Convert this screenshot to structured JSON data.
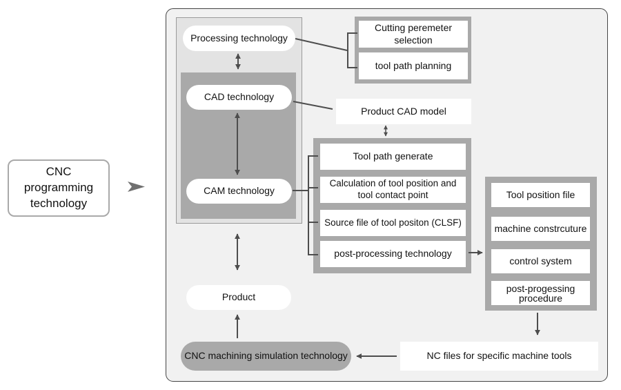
{
  "root": {
    "label": "CNC programming technology"
  },
  "left_column": {
    "processing": "Processing technology",
    "cad": "CAD technology",
    "cam": "CAM technology",
    "product": "Product",
    "simulation": "CNC machining simulation technology"
  },
  "processing_group": {
    "items": [
      "Cutting peremeter selection",
      "tool path planning"
    ]
  },
  "cad_model": {
    "label": "Product CAD model"
  },
  "cam_group": {
    "items": [
      "Tool path generate",
      "Calculation of tool position and tool contact point",
      "Source file of tool positon (CLSF)",
      "post-processing technology"
    ]
  },
  "post_group": {
    "items": [
      "Tool position file",
      "machine constrcuture",
      "control system",
      "post-progessing procedure"
    ]
  },
  "nc_files": {
    "label": "NC files for specific machine tools"
  },
  "colors": {
    "frame_bg": "#f1f1f1",
    "panel_gray": "#a9a9a9",
    "light_panel": "#e3e3e3",
    "line": "#4d4d4d",
    "box": "#ffffff"
  }
}
